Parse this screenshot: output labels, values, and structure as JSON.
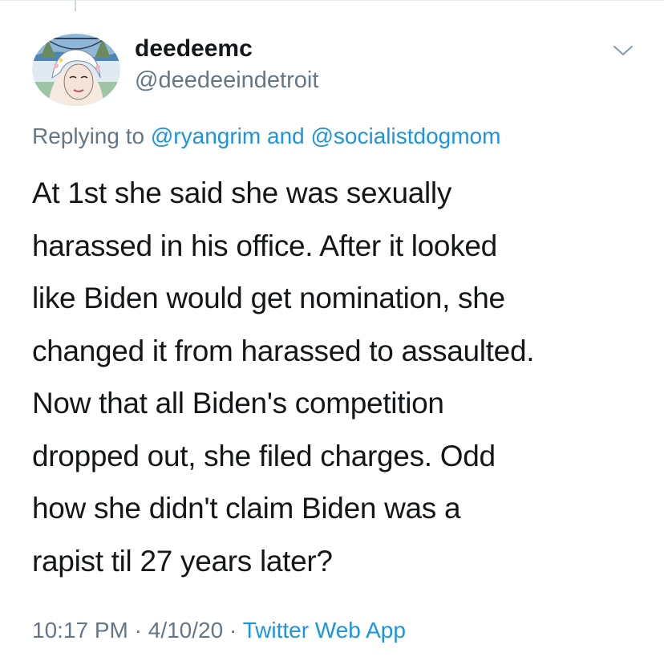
{
  "tweet": {
    "display_name": "deedeemc",
    "handle": "@deedeeindetroit",
    "replying": {
      "prefix": "Replying to",
      "mention1": "@ryangrim",
      "conjunction": "and",
      "mention2": "@socialistdogmom"
    },
    "body_lines": [
      "At 1st she said she was sexually",
      "harassed in his office. After it looked",
      "like Biden would get nomination, she",
      "changed it from harassed to assaulted.",
      "Now that all Biden's competition",
      "dropped out, she filed charges. Odd",
      "how she didn't claim Biden was a",
      "rapist til 27 years later?"
    ],
    "meta": {
      "time": "10:17 PM",
      "separator": "·",
      "date": "4/10/20",
      "source": "Twitter Web App"
    }
  },
  "icons": {
    "avatar": "avatar-illustration",
    "caret": "chevron-down-icon"
  },
  "colors": {
    "text": "#14171a",
    "secondary": "#657786",
    "link": "#1b95e0",
    "divider": "#e6ecf0"
  }
}
